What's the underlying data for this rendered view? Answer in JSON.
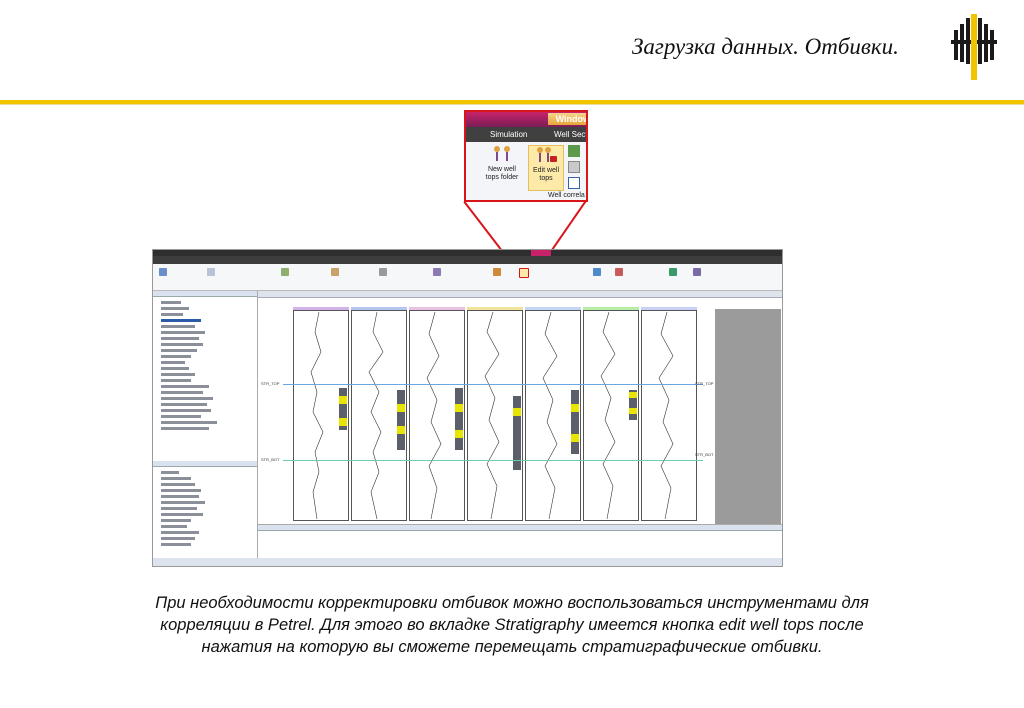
{
  "slide": {
    "title": "Загрузка данных. Отбивки.",
    "caption_line1": "При необходимости корректировки отбивок можно воспользоваться инструментами для",
    "caption_line2": "корреляции в Petrel. Для этого во вкладке Stratigraphy имеется кнопка edit well tops после",
    "caption_line3": "нажатия на которую вы сможете перемещать стратиграфические отбивки."
  },
  "colors": {
    "accent_gold": "#f2c400",
    "callout_red": "#d8151b",
    "logo_black": "#1a1a1a"
  },
  "zoom": {
    "window_label": "Window",
    "tab_simulation": "Simulation",
    "tab_well_section": "Well Secti",
    "btn_new_tops_line1": "New well",
    "btn_new_tops_line2": "tops folder",
    "btn_edit_tops_line1": "Edit well",
    "btn_edit_tops_line2": "tops",
    "group_label": "Well correla"
  },
  "petrel": {
    "top_marker": "STR_TOP",
    "bot_marker": "STR_BOT"
  }
}
